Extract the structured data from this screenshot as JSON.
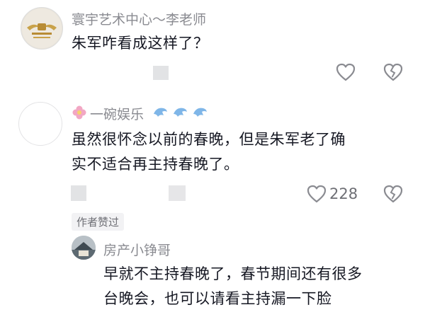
{
  "comments": [
    {
      "author": "寰宇艺术中心～李老师",
      "text": "朱军咋看成这样了？",
      "avatar_icon": "gold-wings-logo-avatar"
    },
    {
      "author": "一碗娱乐",
      "text_line1": "虽然很怀念以前的春晚，但是朱军老了确",
      "text_line2": "实不适合再主持春晚了。",
      "like_count": "228",
      "author_liked_badge": "作者赞过",
      "flower_icon": "pink-flower-icon",
      "badge_icons": [
        "dolphin-icon",
        "dolphin-icon",
        "dolphin-icon"
      ]
    }
  ],
  "reply": {
    "author": "房产小铮哥",
    "text_line1": "早就不主持春晚了，春节期间还有很多",
    "text_line2": "台晚会，也可以请看主持漏一下脸"
  },
  "colors": {
    "name": "#8a8b91",
    "text": "#161823",
    "accent_blue": "#7fb6e8",
    "logo_gold": "#c9a24a"
  }
}
